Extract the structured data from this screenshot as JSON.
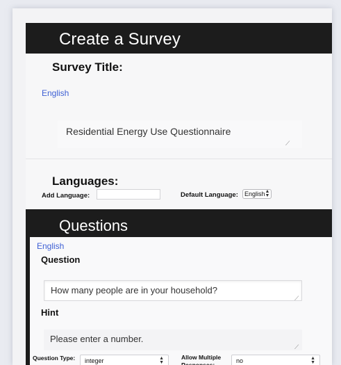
{
  "header": {
    "title": "Create a Survey"
  },
  "survey_title": {
    "label": "Survey Title:",
    "language": "English",
    "value": "Residential Energy Use Questionnaire"
  },
  "languages": {
    "label": "Languages:",
    "add_label": "Add Language:",
    "add_value": "",
    "default_label": "Default Language:",
    "default_value": "English"
  },
  "questions": {
    "heading": "Questions",
    "items": [
      {
        "language": "English",
        "question_label": "Question",
        "question_value": "How many people are in your household?",
        "hint_label": "Hint",
        "hint_value": "Please enter a number.",
        "type_label": "Question Type:",
        "type_value": "integer",
        "multiple_label": "Allow Multiple Responses:",
        "multiple_value": "no"
      }
    ]
  },
  "colors": {
    "header_bg": "#1c1c1c",
    "link": "#3d5fd4",
    "page_bg": "#e9ebf1"
  }
}
